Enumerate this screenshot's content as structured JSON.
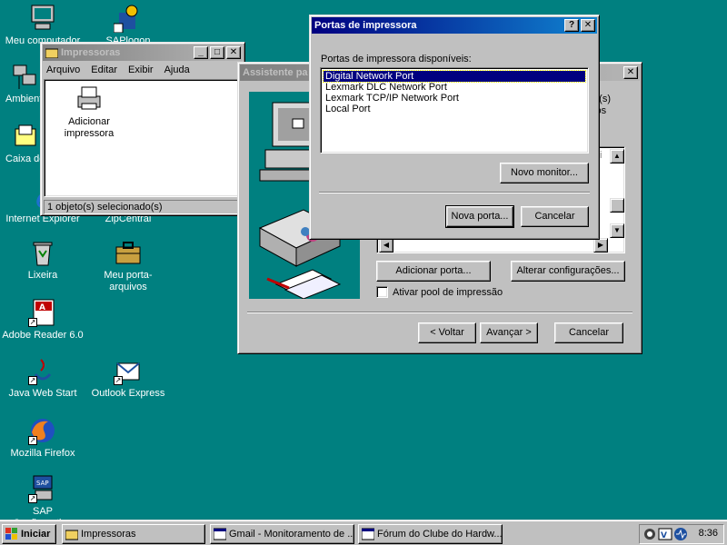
{
  "desktop": {
    "icons": [
      {
        "label": "Meu computador",
        "icon": "my-computer-icon"
      },
      {
        "label": "SAPlogon",
        "icon": "sap-logon-icon"
      },
      {
        "label": "Ambiente",
        "icon": "network-neighborhood-icon"
      },
      {
        "label": "Caixa de",
        "icon": "inbox-icon"
      },
      {
        "label": "Internet Explorer",
        "icon": "internet-explorer-icon"
      },
      {
        "label": "ZipCentral",
        "icon": "zipcentral-icon"
      },
      {
        "label": "Lixeira",
        "icon": "recycle-bin-icon"
      },
      {
        "label": "Meu porta-arquivos",
        "icon": "briefcase-icon"
      },
      {
        "label": "Adobe Reader 6.0",
        "icon": "adobe-reader-icon"
      },
      {
        "label": "Java Web Start",
        "icon": "java-icon"
      },
      {
        "label": "Outlook Express",
        "icon": "outlook-express-icon"
      },
      {
        "label": "Mozilla Firefox",
        "icon": "firefox-icon"
      },
      {
        "label": "SAP Configuration",
        "icon": "sap-configuration-icon"
      }
    ]
  },
  "printers_window": {
    "title": "Impressoras",
    "menu": [
      "Arquivo",
      "Editar",
      "Exibir",
      "Ajuda"
    ],
    "item_label_1": "Adicionar",
    "item_label_2": "impressora",
    "status": "1 objeto(s) selecionado(s)"
  },
  "wizard": {
    "title": "Assistente pa",
    "right_text_1": "ta(s)",
    "right_text_2": "cos",
    "list_fragment": "ssi",
    "add_port_button": "Adicionar porta...",
    "change_config_button": "Alterar configurações...",
    "pool_checkbox": "Ativar pool de impressão",
    "back_button": "< Voltar",
    "next_button": "Avançar >",
    "cancel_button": "Cancelar"
  },
  "ports_dialog": {
    "title": "Portas de impressora",
    "list_label": "Portas de impressora disponíveis:",
    "ports": [
      "Digital Network Port",
      "Lexmark DLC Network Port",
      "Lexmark TCP/IP Network Port",
      "Local Port"
    ],
    "selected_index": 0,
    "new_monitor_button": "Novo monitor...",
    "new_port_button": "Nova porta...",
    "cancel_button": "Cancelar"
  },
  "taskbar": {
    "start_label": "Iniciar",
    "tasks": [
      {
        "label": "Impressoras"
      },
      {
        "label": "Gmail - Monitoramento de ..."
      },
      {
        "label": "Fórum do Clube do Hardw..."
      }
    ],
    "clock": "8:36"
  },
  "colors": {
    "desktop": "#008080",
    "active_title": "#000080",
    "selection": "#000080"
  }
}
